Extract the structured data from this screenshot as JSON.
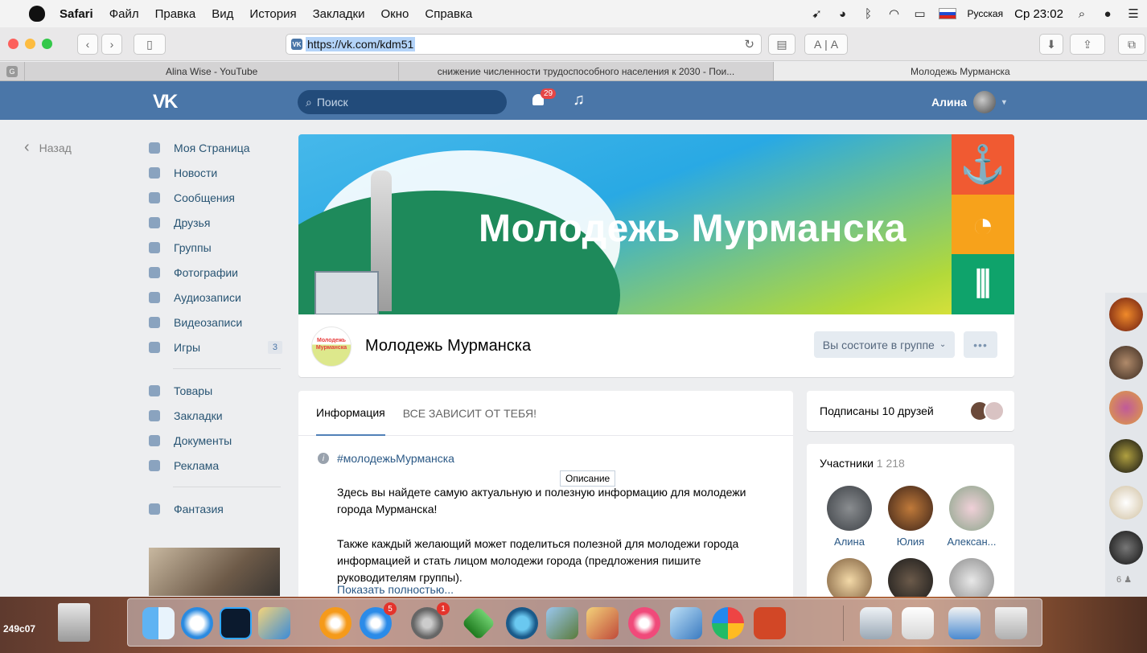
{
  "menubar": {
    "app": "Safari",
    "items": [
      "Файл",
      "Правка",
      "Вид",
      "История",
      "Закладки",
      "Окно",
      "Справка"
    ],
    "input_source": "Русская",
    "clock": "Ср 23:02"
  },
  "browser": {
    "url": "https://vk.com/kdm51",
    "tabs": [
      {
        "label": "Alina Wise - YouTube"
      },
      {
        "label": "снижение численности трудоспособного населения к 2030 - Пои..."
      },
      {
        "label": "Молодежь Мурманска"
      }
    ],
    "sidebar_letter": "G"
  },
  "vk": {
    "logo": "VK",
    "search_placeholder": "Поиск",
    "notifications": "29",
    "user_name": "Алина"
  },
  "back_label": "Назад",
  "sidebar": {
    "items": [
      {
        "label": "Моя Страница",
        "icon": "home-icon"
      },
      {
        "label": "Новости",
        "icon": "news-icon"
      },
      {
        "label": "Сообщения",
        "icon": "messages-icon"
      },
      {
        "label": "Друзья",
        "icon": "friends-icon"
      },
      {
        "label": "Группы",
        "icon": "groups-icon"
      },
      {
        "label": "Фотографии",
        "icon": "camera-icon"
      },
      {
        "label": "Аудиозаписи",
        "icon": "music-icon"
      },
      {
        "label": "Видеозаписи",
        "icon": "video-icon"
      },
      {
        "label": "Игры",
        "icon": "gamepad-icon",
        "count": "3"
      }
    ],
    "items2": [
      {
        "label": "Товары",
        "icon": "bag-icon"
      },
      {
        "label": "Закладки",
        "icon": "star-icon"
      },
      {
        "label": "Документы",
        "icon": "document-icon"
      },
      {
        "label": "Реклама",
        "icon": "megaphone-icon"
      }
    ],
    "items3": [
      {
        "label": "Фантазия",
        "icon": "groups-icon"
      }
    ]
  },
  "group": {
    "cover_title": "Молодежь Мурманска",
    "name": "Молодежь Мурманска",
    "logo_text": "Молодежь Мурманска",
    "member_button": "Вы состоите в группе",
    "more": "•••"
  },
  "info": {
    "tab_info": "Информация",
    "tab_second": "ВСЕ ЗАВИСИТ ОТ ТЕБЯ!",
    "hashtag": "#молодежьМурманска",
    "tooltip": "Описание",
    "para1": "Здесь вы найдете самую актуальную и полезную информацию для молодежи города Мурманска!",
    "para2": "Также каждый желающий может поделиться полезной для молодежи города информацией и стать лицом молодежи города (предложения пишите руководителям группы).",
    "show_more": "Показать полностью..."
  },
  "friends_card": {
    "label": "Подписаны 10 друзей"
  },
  "members": {
    "title": "Участники",
    "count": "1 218",
    "people": [
      {
        "name": "Алина"
      },
      {
        "name": "Юлия"
      },
      {
        "name": "Алексан..."
      }
    ]
  },
  "strip": {
    "count": "6"
  },
  "desktop": {
    "corner_text": "249c07"
  },
  "dock_badges": {
    "appstore": "5",
    "settings": "1"
  },
  "colors": {
    "vk_blue": "#4a76a8",
    "link": "#2a5885",
    "bg": "#edeef0"
  }
}
